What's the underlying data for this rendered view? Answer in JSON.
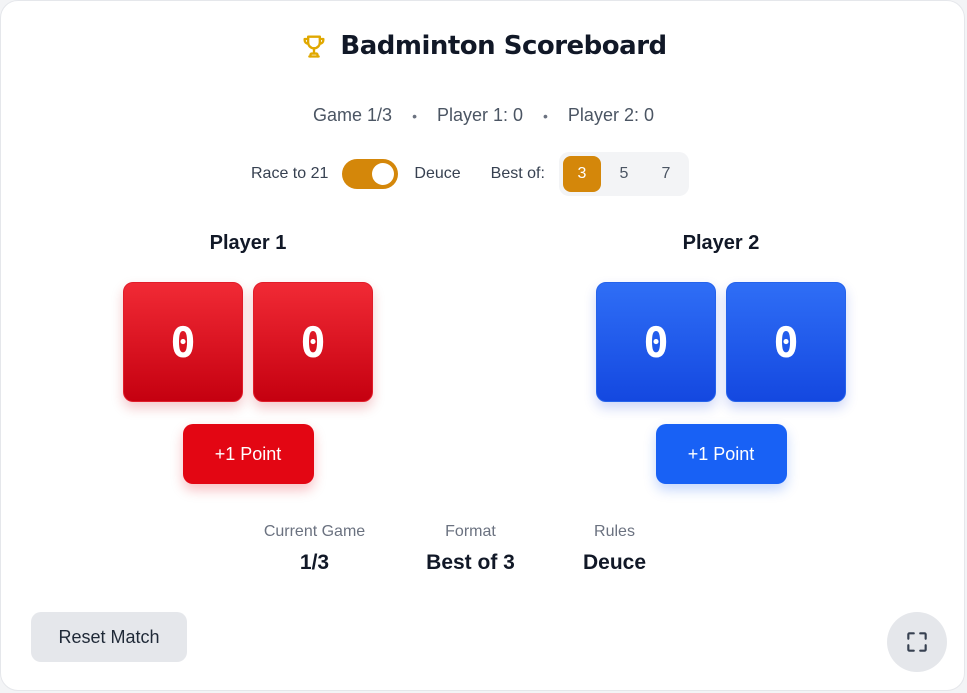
{
  "header": {
    "title": "Badminton Scoreboard",
    "icon": "trophy-icon",
    "icon_color": "#e0a800"
  },
  "status": {
    "game": "Game 1/3",
    "player1": "Player 1: 0",
    "player2": "Player 2: 0",
    "separator": "•"
  },
  "settings": {
    "race_label": "Race to 21",
    "deuce_label": "Deuce",
    "deuce_enabled": true,
    "best_of_label": "Best of:",
    "best_of_options": [
      "3",
      "5",
      "7"
    ],
    "best_of_selected": "3",
    "accent_color": "#d4870a"
  },
  "players": [
    {
      "name": "Player 1",
      "digits": [
        "0",
        "0"
      ],
      "button_label": "+1 Point",
      "color": "#e30613"
    },
    {
      "name": "Player 2",
      "digits": [
        "0",
        "0"
      ],
      "button_label": "+1 Point",
      "color": "#1861f5"
    }
  ],
  "summary": {
    "current_game_label": "Current Game",
    "current_game_value": "1/3",
    "format_label": "Format",
    "format_value": "Best of 3",
    "rules_label": "Rules",
    "rules_value": "Deuce"
  },
  "controls": {
    "reset_label": "Reset Match",
    "fullscreen_icon": "fullscreen-icon"
  }
}
